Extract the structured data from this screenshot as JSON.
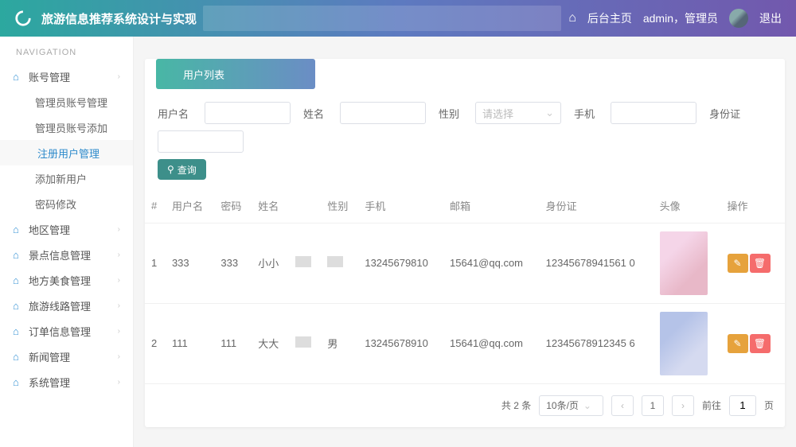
{
  "header": {
    "app_title": "旅游信息推荐系统设计与实现",
    "home": "后台主页",
    "user": "admin，管理员",
    "logout": "退出"
  },
  "sidebar": {
    "nav_label": "NAVIGATION",
    "items": [
      {
        "label": "账号管理",
        "expandable": true,
        "expanded": true,
        "children": [
          {
            "label": "管理员账号管理"
          },
          {
            "label": "管理员账号添加"
          },
          {
            "label": "注册用户管理",
            "active": true
          },
          {
            "label": "添加新用户"
          },
          {
            "label": "密码修改"
          }
        ]
      },
      {
        "label": "地区管理",
        "expandable": true
      },
      {
        "label": "景点信息管理",
        "expandable": true
      },
      {
        "label": "地方美食管理",
        "expandable": true
      },
      {
        "label": "旅游线路管理",
        "expandable": true
      },
      {
        "label": "订单信息管理",
        "expandable": true
      },
      {
        "label": "新闻管理",
        "expandable": true
      },
      {
        "label": "系统管理",
        "expandable": true
      }
    ]
  },
  "panel_title": "用户列表",
  "filters": {
    "username_label": "用户名",
    "name_label": "姓名",
    "gender_label": "性别",
    "gender_placeholder": "请选择",
    "phone_label": "手机",
    "idcard_label": "身份证",
    "search_btn": "查询"
  },
  "table": {
    "headers": [
      "#",
      "用户名",
      "密码",
      "姓名",
      "",
      "性别",
      "手机",
      "邮箱",
      "身份证",
      "头像",
      "操作"
    ],
    "rows": [
      {
        "idx": "1",
        "username": "333",
        "password": "333",
        "name": "小小",
        "gender": "",
        "phone": "13245679810",
        "email": "15641@qq.com",
        "idcard": "12345678941561 0"
      },
      {
        "idx": "2",
        "username": "111",
        "password": "111",
        "name": "大大",
        "gender": "男",
        "phone": "13245678910",
        "email": "15641@qq.com",
        "idcard": "12345678912345 6"
      }
    ]
  },
  "pagination": {
    "total_text": "共 2 条",
    "page_size_text": "10条/页",
    "current": "1",
    "goto_prefix": "前往",
    "goto_value": "1",
    "goto_suffix": "页"
  }
}
